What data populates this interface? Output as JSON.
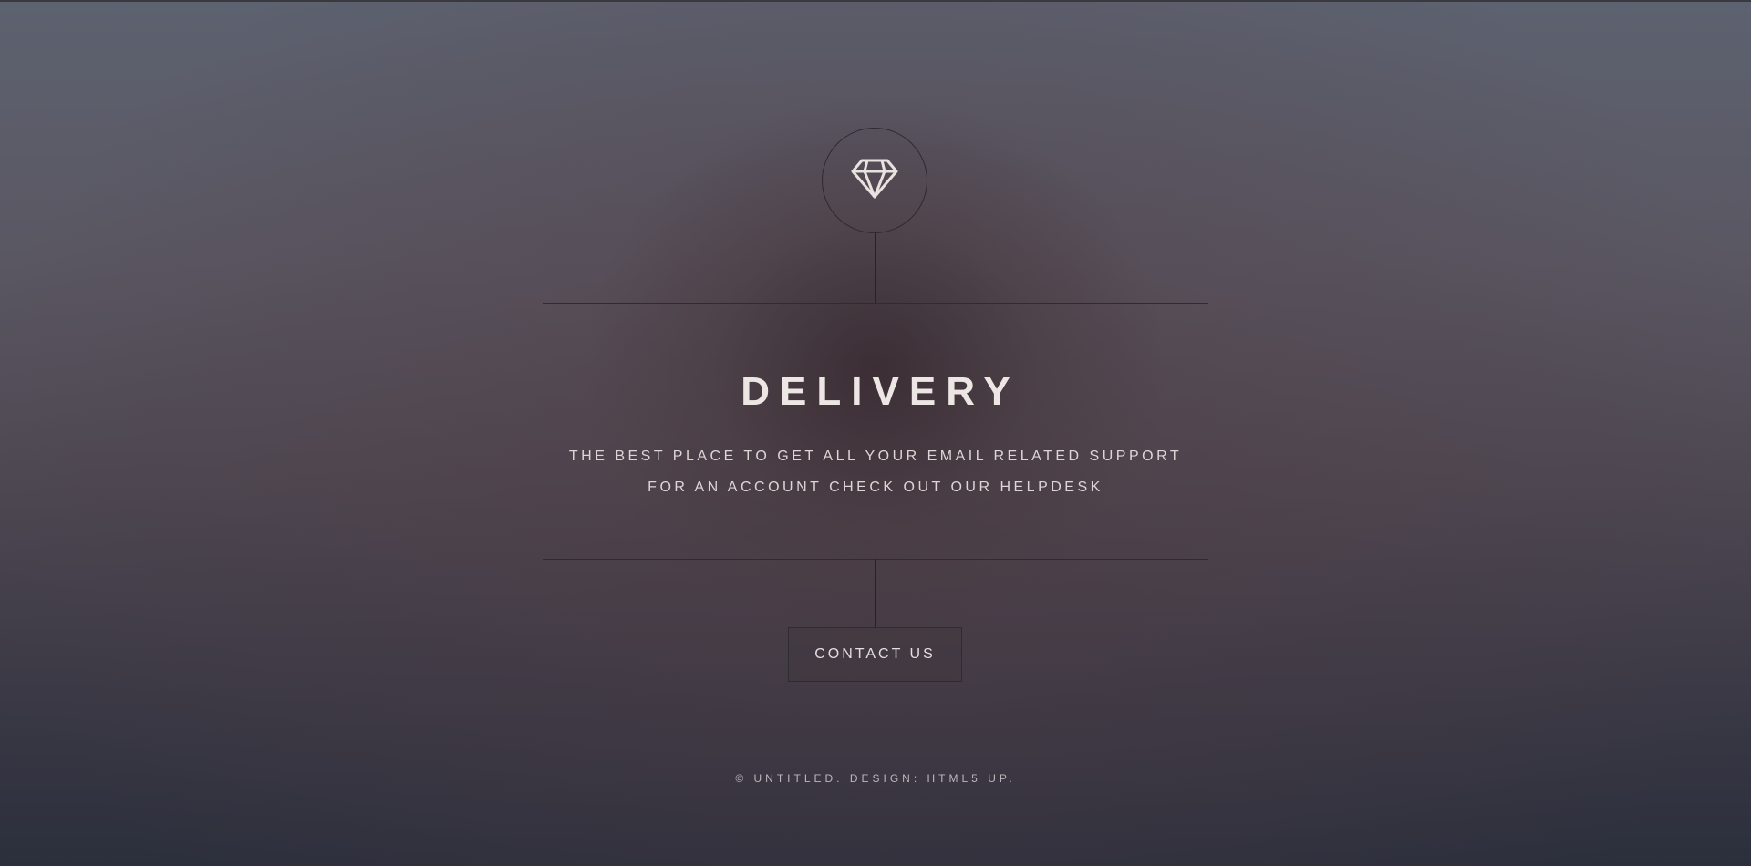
{
  "logo": {
    "icon": "diamond-icon"
  },
  "header": {
    "title": "DELIVERY",
    "description_line1": "THE BEST PLACE TO GET ALL YOUR EMAIL RELATED SUPPORT",
    "description_line2": "FOR AN ACCOUNT CHECK OUT OUR HELPDESK"
  },
  "actions": {
    "contact_label": "CONTACT US"
  },
  "footer": {
    "copyright": "© UNTITLED. DESIGN: HTML5 UP."
  },
  "colors": {
    "text": "#ece6e4",
    "lines": "#2e2b31",
    "background_top": "#5d6270",
    "background_bottom": "#2b2f3c"
  }
}
